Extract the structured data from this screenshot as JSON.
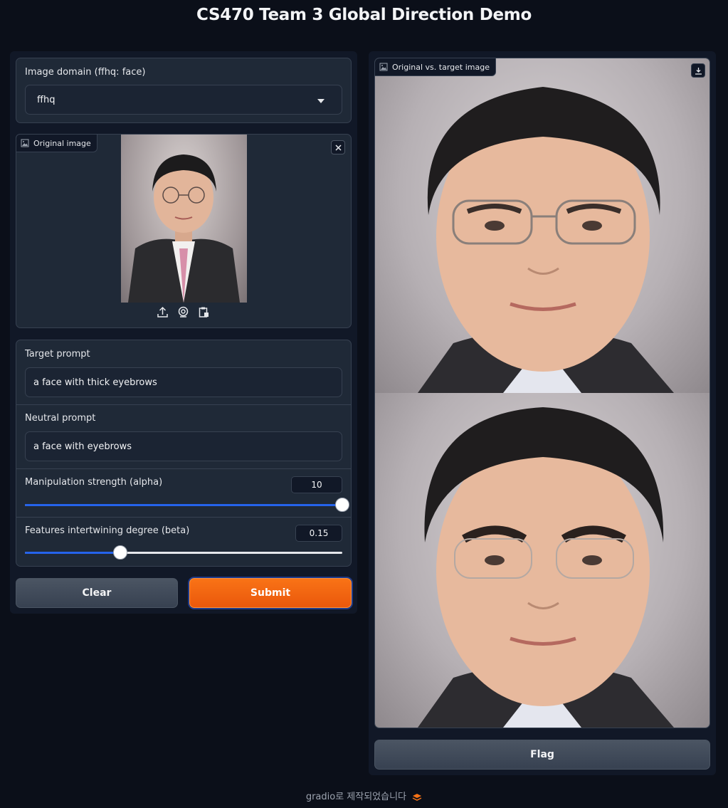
{
  "page": {
    "title": "CS470 Team 3 Global Direction Demo"
  },
  "domain": {
    "label": "Image domain (ffhq: face)",
    "selected": "ffhq"
  },
  "original_image": {
    "label": "Original image",
    "source_icons": [
      "upload-icon",
      "webcam-icon",
      "clipboard-icon"
    ]
  },
  "target_prompt": {
    "label": "Target prompt",
    "value": "a face with thick eyebrows"
  },
  "neutral_prompt": {
    "label": "Neutral prompt",
    "value": "a face with eyebrows"
  },
  "alpha": {
    "label": "Manipulation strength (alpha)",
    "value": "10",
    "fraction": 1.0
  },
  "beta": {
    "label": "Features intertwining degree (beta)",
    "value": "0.15",
    "fraction": 0.3
  },
  "buttons": {
    "clear": "Clear",
    "submit": "Submit",
    "flag": "Flag"
  },
  "output": {
    "label": "Original vs. target image"
  },
  "footer": {
    "text": "gradio로 제작되었습니다"
  },
  "colors": {
    "accent": "#f97316",
    "slider": "#2563eb",
    "background": "#0b0f19"
  }
}
